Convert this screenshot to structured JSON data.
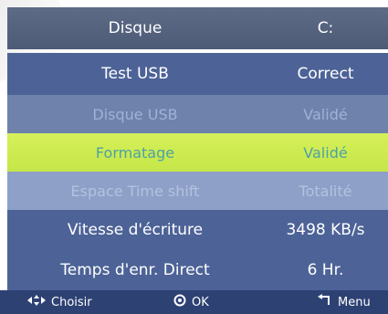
{
  "header": {
    "label": "Disque",
    "value": "C:"
  },
  "rows": [
    {
      "label": "Test USB",
      "value": "Correct"
    },
    {
      "label": "Disque USB",
      "value": "Validé"
    },
    {
      "label": "Formatage",
      "value": "Validé"
    },
    {
      "label": "Espace Time shift",
      "value": "Totalité"
    },
    {
      "label": "Vitesse d'écriture",
      "value": "3498 KB/s"
    },
    {
      "label": "Temps d'enr. Direct",
      "value": "6 Hr."
    }
  ],
  "footer": {
    "choose": {
      "icon": "arrows-icon",
      "label": "Choisir"
    },
    "ok": {
      "icon": "ok-circle-icon",
      "label": "OK"
    },
    "menu": {
      "icon": "return-arrow-icon",
      "label": "Menu"
    }
  },
  "colors": {
    "header_bg": "#56637f",
    "row_bg": "#4d6397",
    "selected_bg": "#cfec52",
    "selected_text": "#4da1a6",
    "footer_bg": "#2d4173"
  }
}
